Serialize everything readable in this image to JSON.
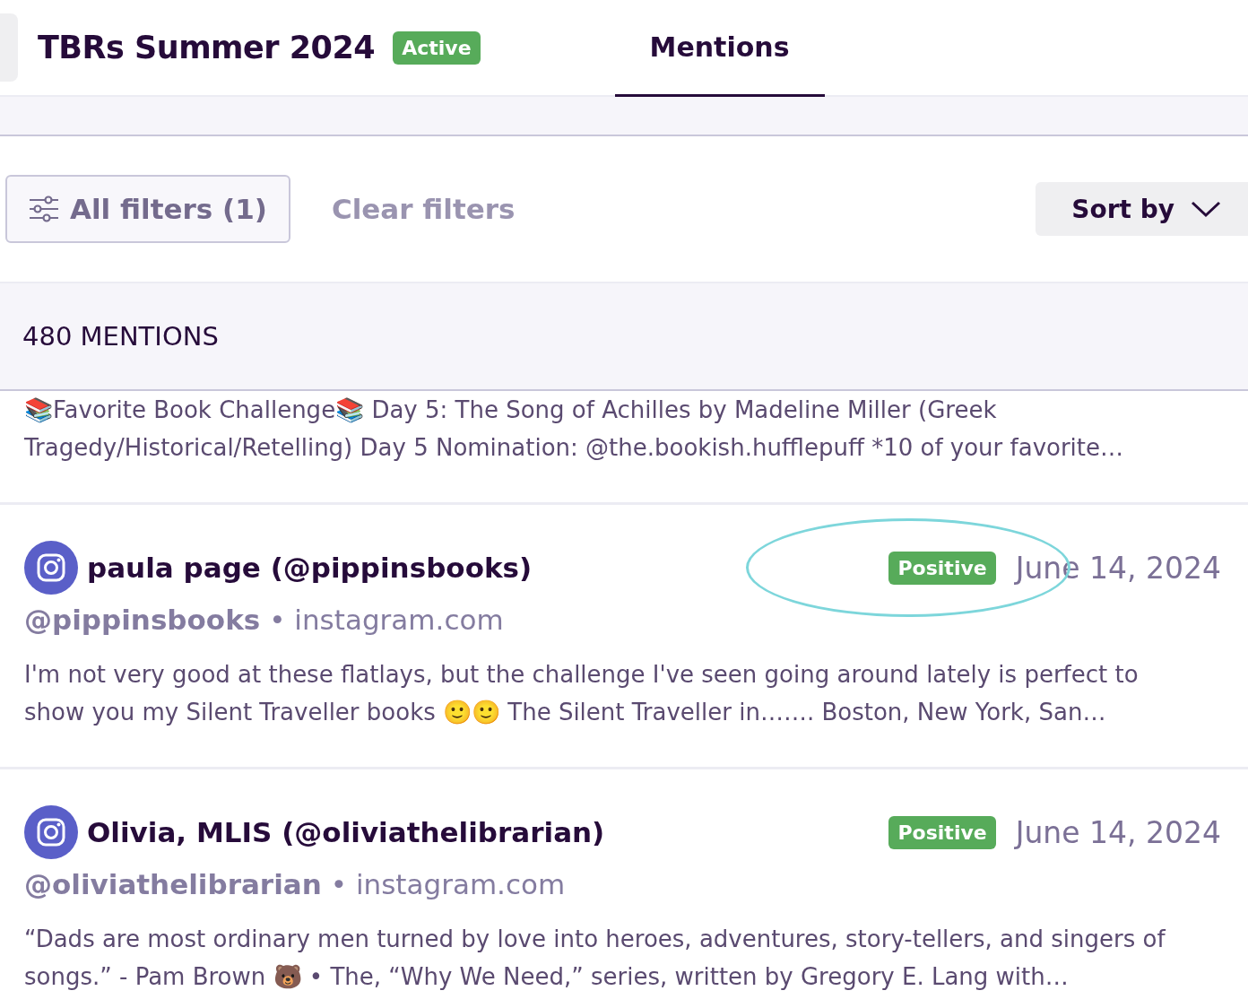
{
  "header": {
    "title": "TBRs Summer 2024",
    "status": "Active"
  },
  "tabs": [
    {
      "label": "Mentions",
      "selected": true
    }
  ],
  "filters": {
    "all_filters": "All filters (1)",
    "clear": "Clear filters",
    "sort": "Sort by"
  },
  "mentions_count": "480 MENTIONS",
  "mentions": [
    {
      "kind": "snippet",
      "text": "📚Favorite Book Challenge📚 Day 5: The Song of Achilles by Madeline Miller (Greek Tragedy/Historical/Retelling) Day 5 Nomination: @the.bookish.hufflepuff *10 of your favorite…"
    },
    {
      "kind": "post",
      "author": "paula page (@pippinsbooks)",
      "handle": "@pippinsbooks",
      "source": "• instagram.com",
      "sentiment": "Positive",
      "date": "June 14, 2024",
      "circled": true,
      "text": "I'm not very good at these flatlays, but the challenge I've seen going around lately is perfect to show you my Silent Traveller books 🙂🙂 The Silent Traveller in……. Boston, New York, San…"
    },
    {
      "kind": "post",
      "author": "Olivia, MLIS (@oliviathelibrarian)",
      "handle": "@oliviathelibrarian",
      "source": "• instagram.com",
      "sentiment": "Positive",
      "date": "June 14, 2024",
      "circled": false,
      "text": "“Dads are most ordinary men turned by love into heroes, adventures, story-tellers, and singers of songs.” - Pam Brown 🐻 • The, “Why We Need,” series, written by Gregory E. Lang with…"
    }
  ]
}
